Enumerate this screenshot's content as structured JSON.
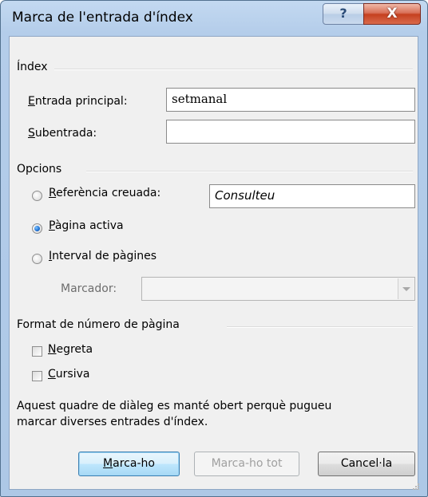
{
  "window": {
    "title": "Marca de l'entrada d'índex",
    "help_glyph": "?",
    "close_glyph": "X"
  },
  "index_group": {
    "label": "Índex",
    "main_entry_label": "Entrada principal:",
    "main_entry_value": "setmanal",
    "subentry_label": "Subentrada:",
    "subentry_value": ""
  },
  "options_group": {
    "label": "Opcions",
    "cross_reference_label": "Referència creuada:",
    "cross_reference_value": "Consulteu",
    "current_page_label": "Pàgina activa",
    "page_range_label": "Interval de pàgines",
    "bookmark_label": "Marcador:",
    "bookmark_value": "",
    "selected_option": "current_page"
  },
  "page_number_format": {
    "label": "Format de número de pàgina",
    "bold_label": "Negreta",
    "bold_checked": false,
    "italic_label": "Cursiva",
    "italic_checked": false
  },
  "info_text_line1": "Aquest quadre de diàleg es manté obert perquè pugueu",
  "info_text_line2": "marcar diverses entrades d'índex.",
  "buttons": {
    "mark_label": "Marca-ho",
    "mark_all_label": "Marca-ho tot",
    "cancel_label": "Cancel·la"
  }
}
